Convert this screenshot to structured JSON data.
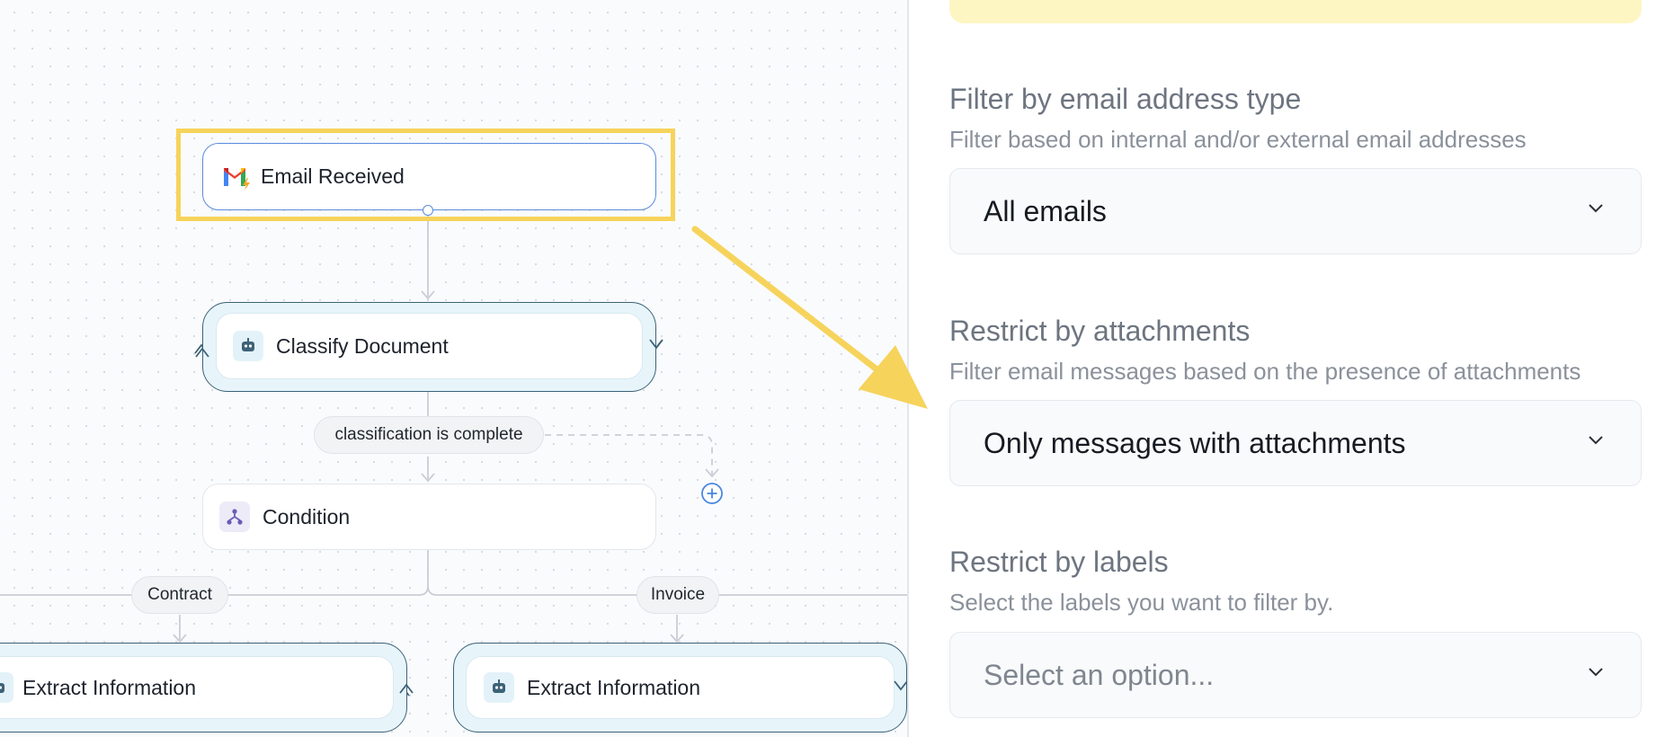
{
  "canvas": {
    "nodes": {
      "trigger": {
        "label": "Email Received",
        "icon": "gmail-icon"
      },
      "classify": {
        "label": "Classify Document",
        "icon": "robot-icon"
      },
      "condition": {
        "label": "Condition",
        "icon": "branch-icon"
      },
      "extract_left": {
        "label": "Extract Information",
        "icon": "robot-icon"
      },
      "extract_right": {
        "label": "Extract Information",
        "icon": "robot-icon"
      }
    },
    "edge_labels": {
      "classification": "classification is complete",
      "contract": "Contract",
      "invoice": "Invoice"
    },
    "add_button_icon": "plus-circle-icon"
  },
  "panel": {
    "sections": [
      {
        "title": "Filter by email address type",
        "description": "Filter based on internal and/or external email addresses",
        "value": "All emails"
      },
      {
        "title": "Restrict by attachments",
        "description": "Filter email messages based on the presence of attachments",
        "value": "Only messages with attachments"
      },
      {
        "title": "Restrict by labels",
        "description": "Select the labels you want to filter by.",
        "placeholder": "Select an option..."
      }
    ]
  },
  "colors": {
    "highlight": "#f6d35b",
    "selected_border": "#5a8bdc",
    "loop_border": "#3d6277",
    "loop_fill": "#e7f5fb",
    "add_button": "#4a86e0"
  }
}
